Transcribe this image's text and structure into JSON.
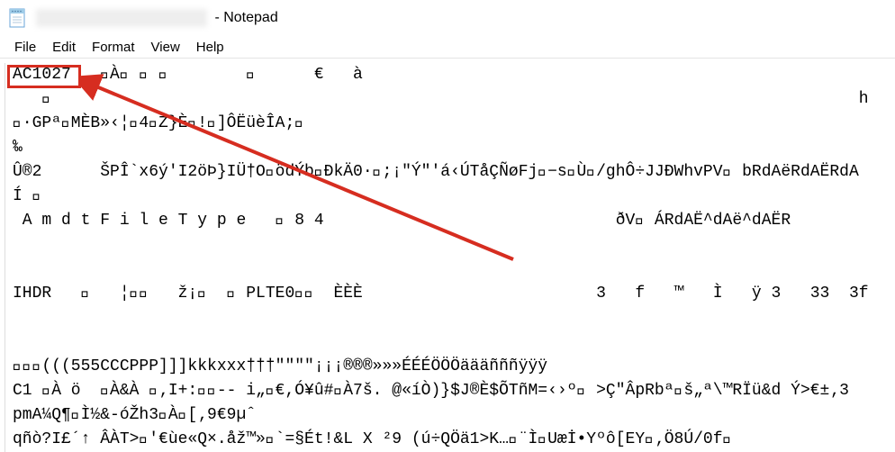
{
  "window": {
    "title_suffix": " - Notepad"
  },
  "menu": {
    "file": "File",
    "edit": "Edit",
    "format": "Format",
    "view": "View",
    "help": "Help"
  },
  "content": {
    "lines": [
      "AC1027   ￿À￿ ￿ ￿        ￿      €   à",
      "   ￿                                                                                   h",
      "￿·GPª￿MÈB»‹¦￿4￿Z}È￿!￿]ÔËüèÎA;￿",
      "‰",
      "Û®2      ŠPÎ`x6ý'I2öÞ}IÜ†O￿ödÝb￿ÐkÄ0·￿;¡\"Ý\"'á‹ÚTåÇÑøFj￿−s￿Ù￿/ghÔ÷JJÐWhvPV￿ bRdAëRdAËRdA",
      "Í ￿",
      " A m d t F i l e T y p e   ￿ 8 4                              ðV￿ ÁRdAË^dAë^dAËR",
      "",
      "",
      "IHDR   ￿   ¦￿￿   ž¡￿  ￿ PLTE0￿￿  ÈÈÈ                        3   f   ™   Ì   ÿ 3   33  3f",
      "",
      "",
      "￿￿￿(((555CCCPPP]]]kkkxxx†††\"\"\"\"¡¡¡®®®»»»ÉÉÉÖÖÖäääñññÿÿÿ",
      "C1 ￿À ö  ￿À&À ￿‚I+:￿￿-- i„￿€,Ó¥û#￿À7š. @«íÒ)}$J®È$ÕTñM=‹›º￿ >Ç\"ÂpRbª￿š„ª\\™RÏü&d Ý>€±‚3",
      "pmA¼Q¶￿Ì½&-óŽh3￿À￿[‚9€9µˆ",
      "qñò?I£´↑ ÂÀT>￿'€ùe«Q×.åž™»￿`=§Ét!&L X ²9 (ú÷QÖä1>K…￿¨Ì￿Uæİ•Yºô[EY￿‚Ö8Ú/0f￿"
    ]
  },
  "annotation": {
    "highlighted_text": "AC1027"
  }
}
